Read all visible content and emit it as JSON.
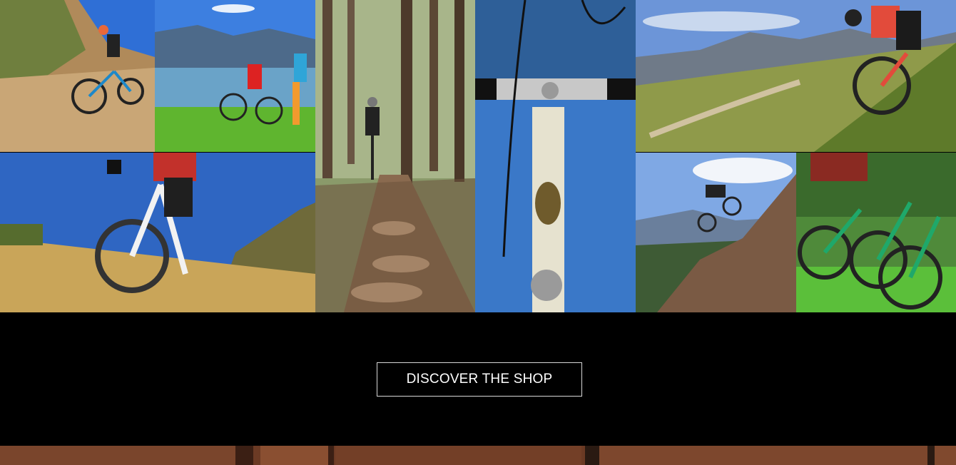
{
  "gallery": {
    "tiles": [
      {
        "name": "photo-hillside-rider",
        "subject": "cyclist riding mountain bike on dirt hill path"
      },
      {
        "name": "photo-lake-cyclists",
        "subject": "two cyclists with bikes beside a mountain lake"
      },
      {
        "name": "photo-sunny-trail-rider",
        "subject": "rider on white mountain bike in dry grass"
      },
      {
        "name": "photo-forest-trail",
        "subject": "rider on rocky forest trail"
      },
      {
        "name": "photo-bike-headset",
        "subject": "close-up of bicycle handlebar and head badge"
      },
      {
        "name": "photo-downhill-rider",
        "subject": "downhill rider on alpine meadow"
      },
      {
        "name": "photo-jump-rider",
        "subject": "rider jumping over rocks"
      },
      {
        "name": "photo-green-cruisers",
        "subject": "row of green cruiser bicycles on lawn"
      }
    ]
  },
  "cta": {
    "label": "DISCOVER THE SHOP"
  },
  "colors": {
    "background": "#000000",
    "button_border": "#d8d8d8",
    "button_text": "#ffffff",
    "wood": "#6b3a24"
  }
}
